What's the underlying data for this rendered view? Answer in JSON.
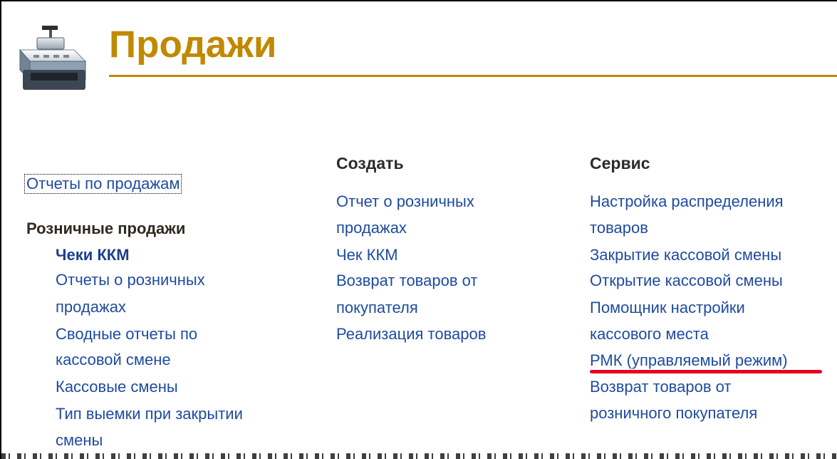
{
  "page": {
    "title": "Продажи",
    "icon": "cash-register-icon",
    "accent_color": "#c08900",
    "link_color": "#1f4ba0"
  },
  "left_column": {
    "main_link": "Отчеты по продажам",
    "section_title": "Розничные продажи",
    "items": [
      {
        "label": "Чеки ККМ"
      },
      {
        "label": "Отчеты о розничных"
      },
      {
        "label": "продажах"
      },
      {
        "label": "Сводные отчеты по"
      },
      {
        "label": "кассовой смене"
      },
      {
        "label": "Кассовые смены"
      },
      {
        "label": "Тип выемки при закрытии"
      },
      {
        "label": "смены"
      }
    ]
  },
  "create_column": {
    "title": "Создать",
    "items": [
      {
        "label": "Отчет о розничных"
      },
      {
        "label": "продажах"
      },
      {
        "label": "Чек ККМ"
      },
      {
        "label": "Возврат товаров от"
      },
      {
        "label": "покупателя"
      },
      {
        "label": "Реализация товаров"
      }
    ]
  },
  "service_column": {
    "title": "Сервис",
    "items": [
      {
        "label": "Настройка распределения"
      },
      {
        "label": "товаров"
      },
      {
        "label": "Закрытие кассовой смены"
      },
      {
        "label": "Открытие кассовой смены"
      },
      {
        "label": "Помощник настройки"
      },
      {
        "label": "кассового места"
      },
      {
        "label": "РМК (управляемый режим)"
      },
      {
        "label": "Возврат товаров от"
      },
      {
        "label": "розничного покупателя"
      }
    ],
    "highlight_color": "#e5001d"
  }
}
